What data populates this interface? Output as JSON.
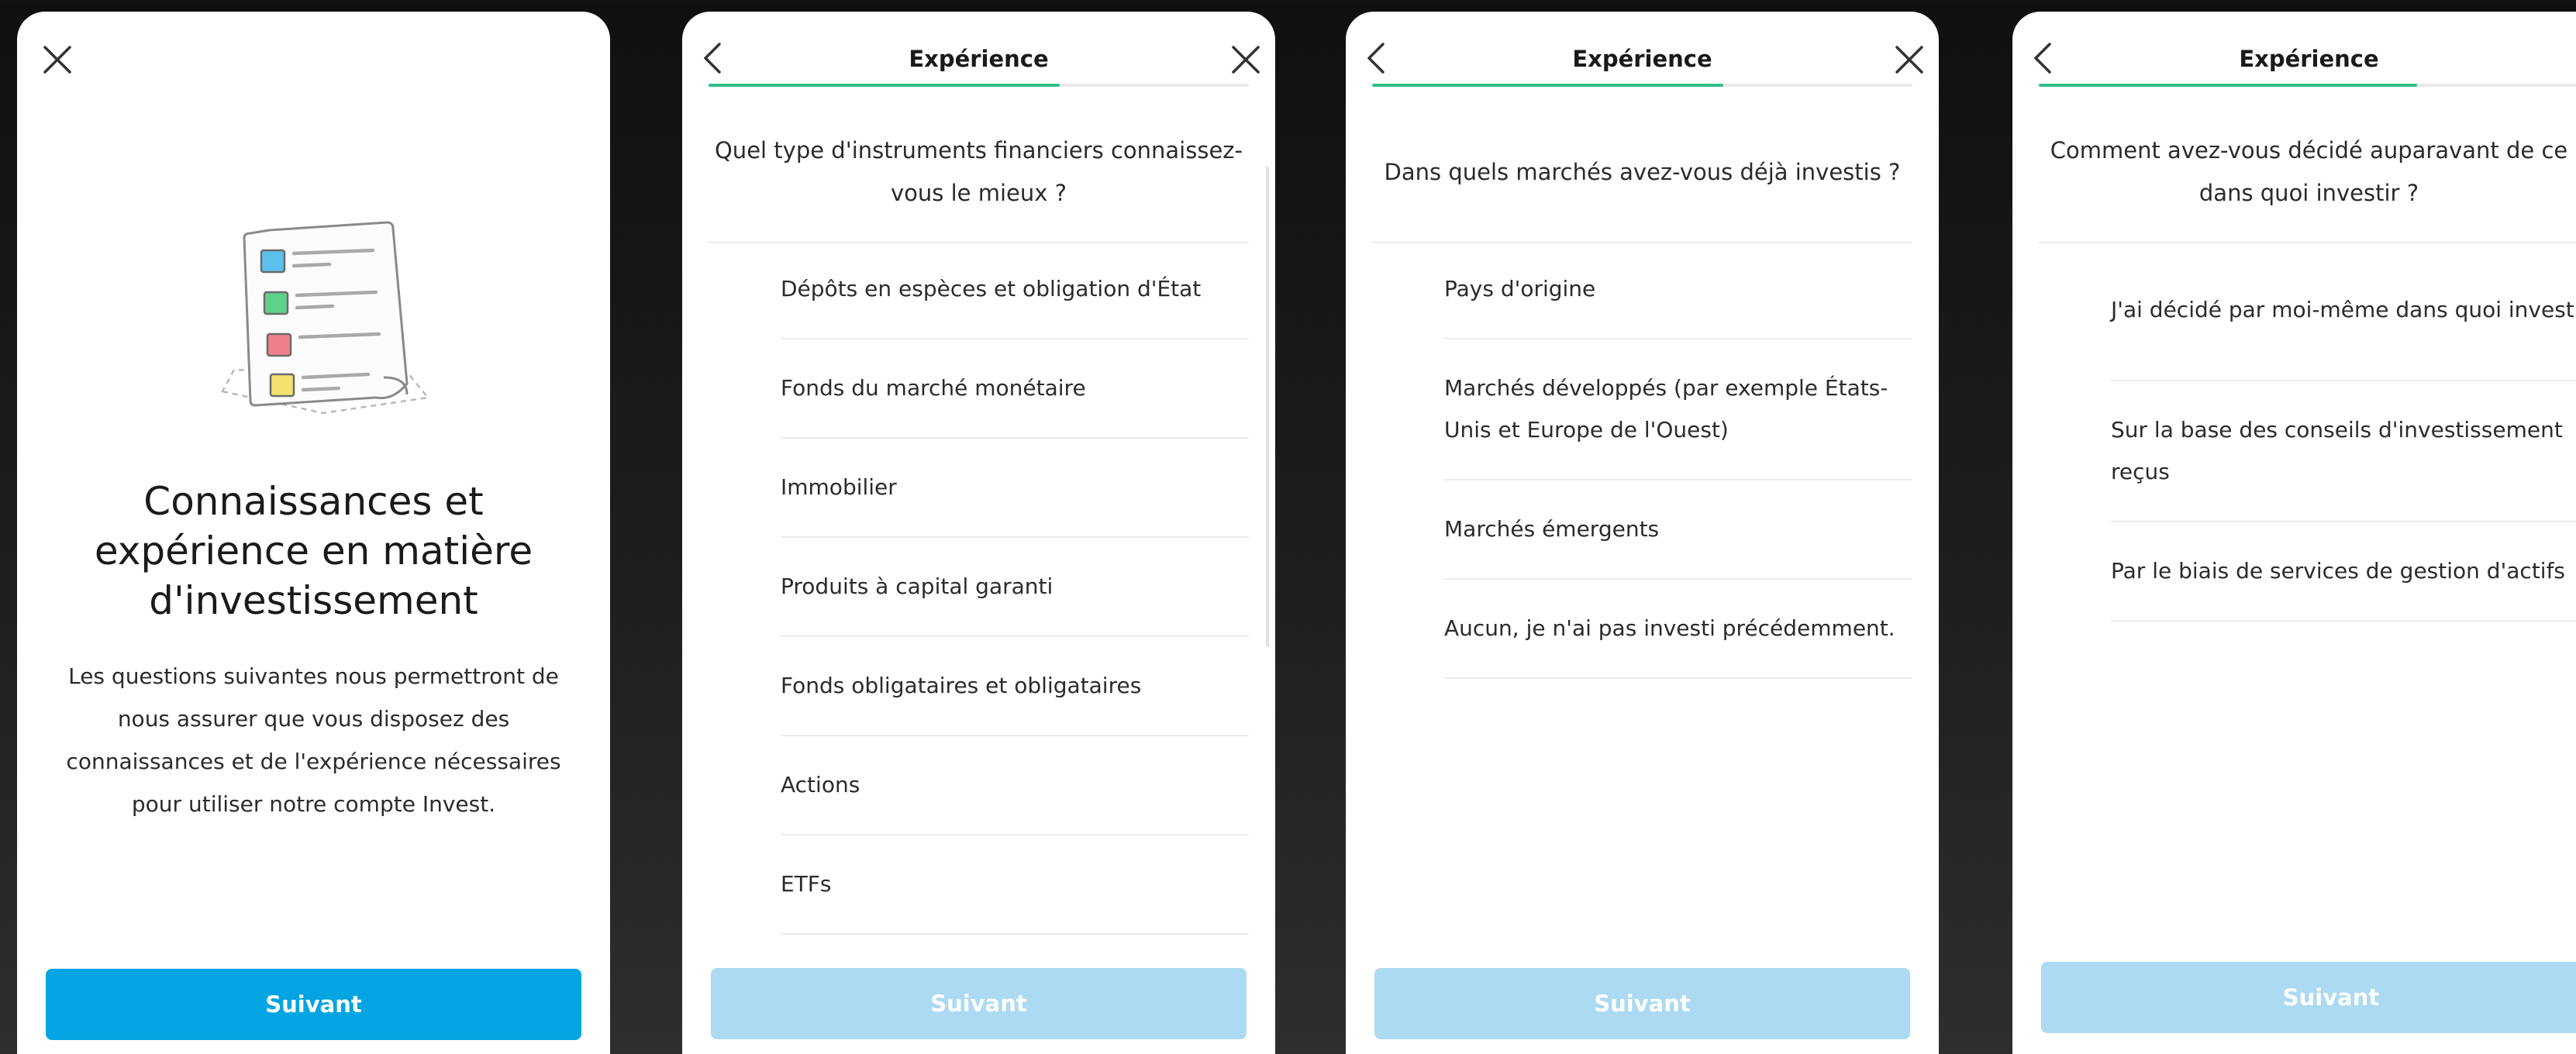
{
  "intro": {
    "heading": "Connaissances et expérience en matière d'investissement",
    "body": "Les questions suivantes nous permettront de nous assurer que vous disposez des connaissances et de l'expérience nécessaires pour utiliser notre compte Invest.",
    "button_label": "Suivant"
  },
  "step2": {
    "title": "Expérience",
    "progress": 0.65,
    "question": "Quel type d'instruments financiers connaissez-vous le mieux ?",
    "options": [
      "Dépôts en espèces et obligation d'État",
      "Fonds du marché monétaire",
      "Immobilier",
      "Produits à capital garanti",
      "Fonds obligataires et obligataires",
      "Actions",
      "ETFs"
    ],
    "button_label": "Suivant"
  },
  "step3": {
    "title": "Expérience",
    "progress": 0.65,
    "question": "Dans quels marchés avez-vous déjà investis ?",
    "options": [
      "Pays d'origine",
      "Marchés développés (par exemple États-Unis et Europe de l'Ouest)",
      "Marchés émergents",
      "Aucun, je n'ai pas investi précédemment."
    ],
    "button_label": "Suivant"
  },
  "step4": {
    "title": "Expérience",
    "progress": 0.65,
    "question": "Comment avez-vous décidé auparavant de ce dans quoi investir ?",
    "options": [
      "J'ai décidé par moi-même dans quoi investir",
      "Sur la base des conseils d'investissement reçus",
      "Par le biais de services de gestion d'actifs"
    ],
    "button_label": "Suivant"
  },
  "colors": {
    "accent_blue": "#02a5e2",
    "disabled_blue": "#abdaf2",
    "progress_green": "#2fbf86"
  },
  "icons": [
    "close-icon",
    "back-icon",
    "document-list-icon"
  ]
}
